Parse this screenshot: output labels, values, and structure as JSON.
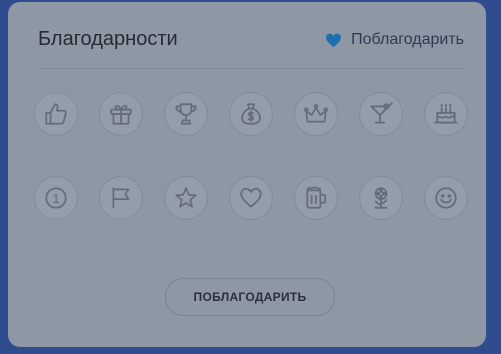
{
  "panel": {
    "title": "Благодарности",
    "thank_link": "Поблагодарить",
    "button_label": "ПОБЛАГОДАРИТЬ"
  },
  "colors": {
    "background": "#2f4d8e",
    "card": "#8e97a4",
    "heart": "#1f6fb0"
  },
  "icons_row1": [
    "thumbs-up-icon",
    "gift-icon",
    "trophy-icon",
    "money-bag-icon",
    "crown-icon",
    "cocktail-icon",
    "cake-icon"
  ],
  "icons_row2": [
    "number-one-icon",
    "flag-icon",
    "star-icon",
    "heart-icon",
    "beer-mug-icon",
    "flower-icon",
    "smiley-icon"
  ],
  "numeral": "1"
}
